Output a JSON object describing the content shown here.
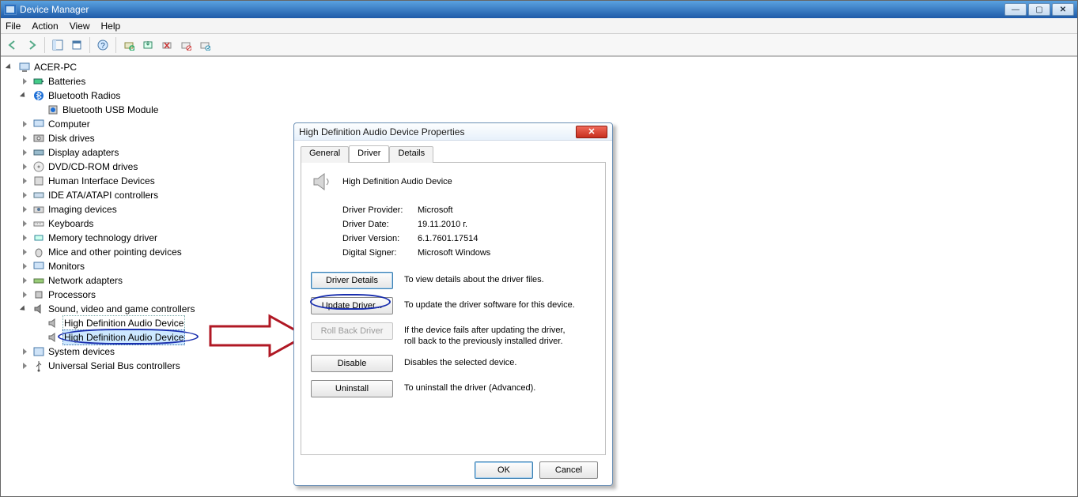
{
  "window": {
    "title": "Device Manager"
  },
  "menus": {
    "file": "File",
    "action": "Action",
    "view": "View",
    "help": "Help"
  },
  "tree": {
    "root": "ACER-PC",
    "items": [
      "Batteries",
      "Bluetooth Radios",
      "Bluetooth USB Module",
      "Computer",
      "Disk drives",
      "Display adapters",
      "DVD/CD-ROM drives",
      "Human Interface Devices",
      "IDE ATA/ATAPI controllers",
      "Imaging devices",
      "Keyboards",
      "Memory technology driver",
      "Mice and other pointing devices",
      "Monitors",
      "Network adapters",
      "Processors",
      "Sound, video and game controllers",
      "High Definition Audio Device",
      "High Definition Audio Device",
      "System devices",
      "Universal Serial Bus controllers"
    ]
  },
  "dialog": {
    "title": "High Definition Audio Device Properties",
    "tabs": {
      "general": "General",
      "driver": "Driver",
      "details": "Details"
    },
    "device_name": "High Definition Audio Device",
    "fields": {
      "provider_label": "Driver Provider:",
      "provider_value": "Microsoft",
      "date_label": "Driver Date:",
      "date_value": "19.11.2010 г.",
      "version_label": "Driver Version:",
      "version_value": "6.1.7601.17514",
      "signer_label": "Digital Signer:",
      "signer_value": "Microsoft Windows"
    },
    "buttons": {
      "details": "Driver Details",
      "details_desc": "To view details about the driver files.",
      "update": "Update Driver...",
      "update_desc": "To update the driver software for this device.",
      "rollback": "Roll Back Driver",
      "rollback_desc": "If the device fails after updating the driver, roll back to the previously installed driver.",
      "disable": "Disable",
      "disable_desc": "Disables the selected device.",
      "uninstall": "Uninstall",
      "uninstall_desc": "To uninstall the driver (Advanced).",
      "ok": "OK",
      "cancel": "Cancel"
    }
  }
}
